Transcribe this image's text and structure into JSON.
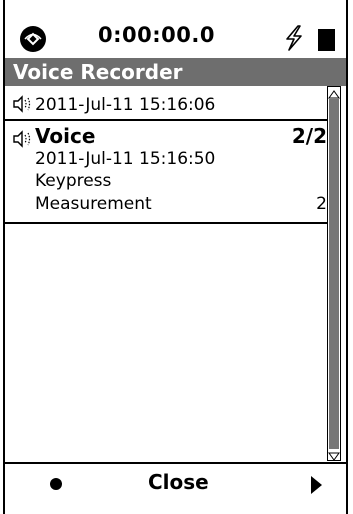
{
  "status": {
    "time": "0:00:00.0"
  },
  "title": "Voice Recorder",
  "recordings": [
    {
      "timestamp": "2011-Jul-11 15:16:06"
    },
    {
      "label": "Voice",
      "counter": "2/2",
      "timestamp": "2011-Jul-11 15:16:50",
      "trigger": "Keypress",
      "measurement_label": "Measurement",
      "measurement_value": "2"
    }
  ],
  "bottom_bar": {
    "close_label": "Close"
  },
  "icons": {
    "status": "sound-meter-icon",
    "power": "lightning-bolt-icon",
    "battery": "battery-icon",
    "speaker": "speaker-icon",
    "record": "record-dot-icon",
    "next": "play-arrow-icon"
  }
}
